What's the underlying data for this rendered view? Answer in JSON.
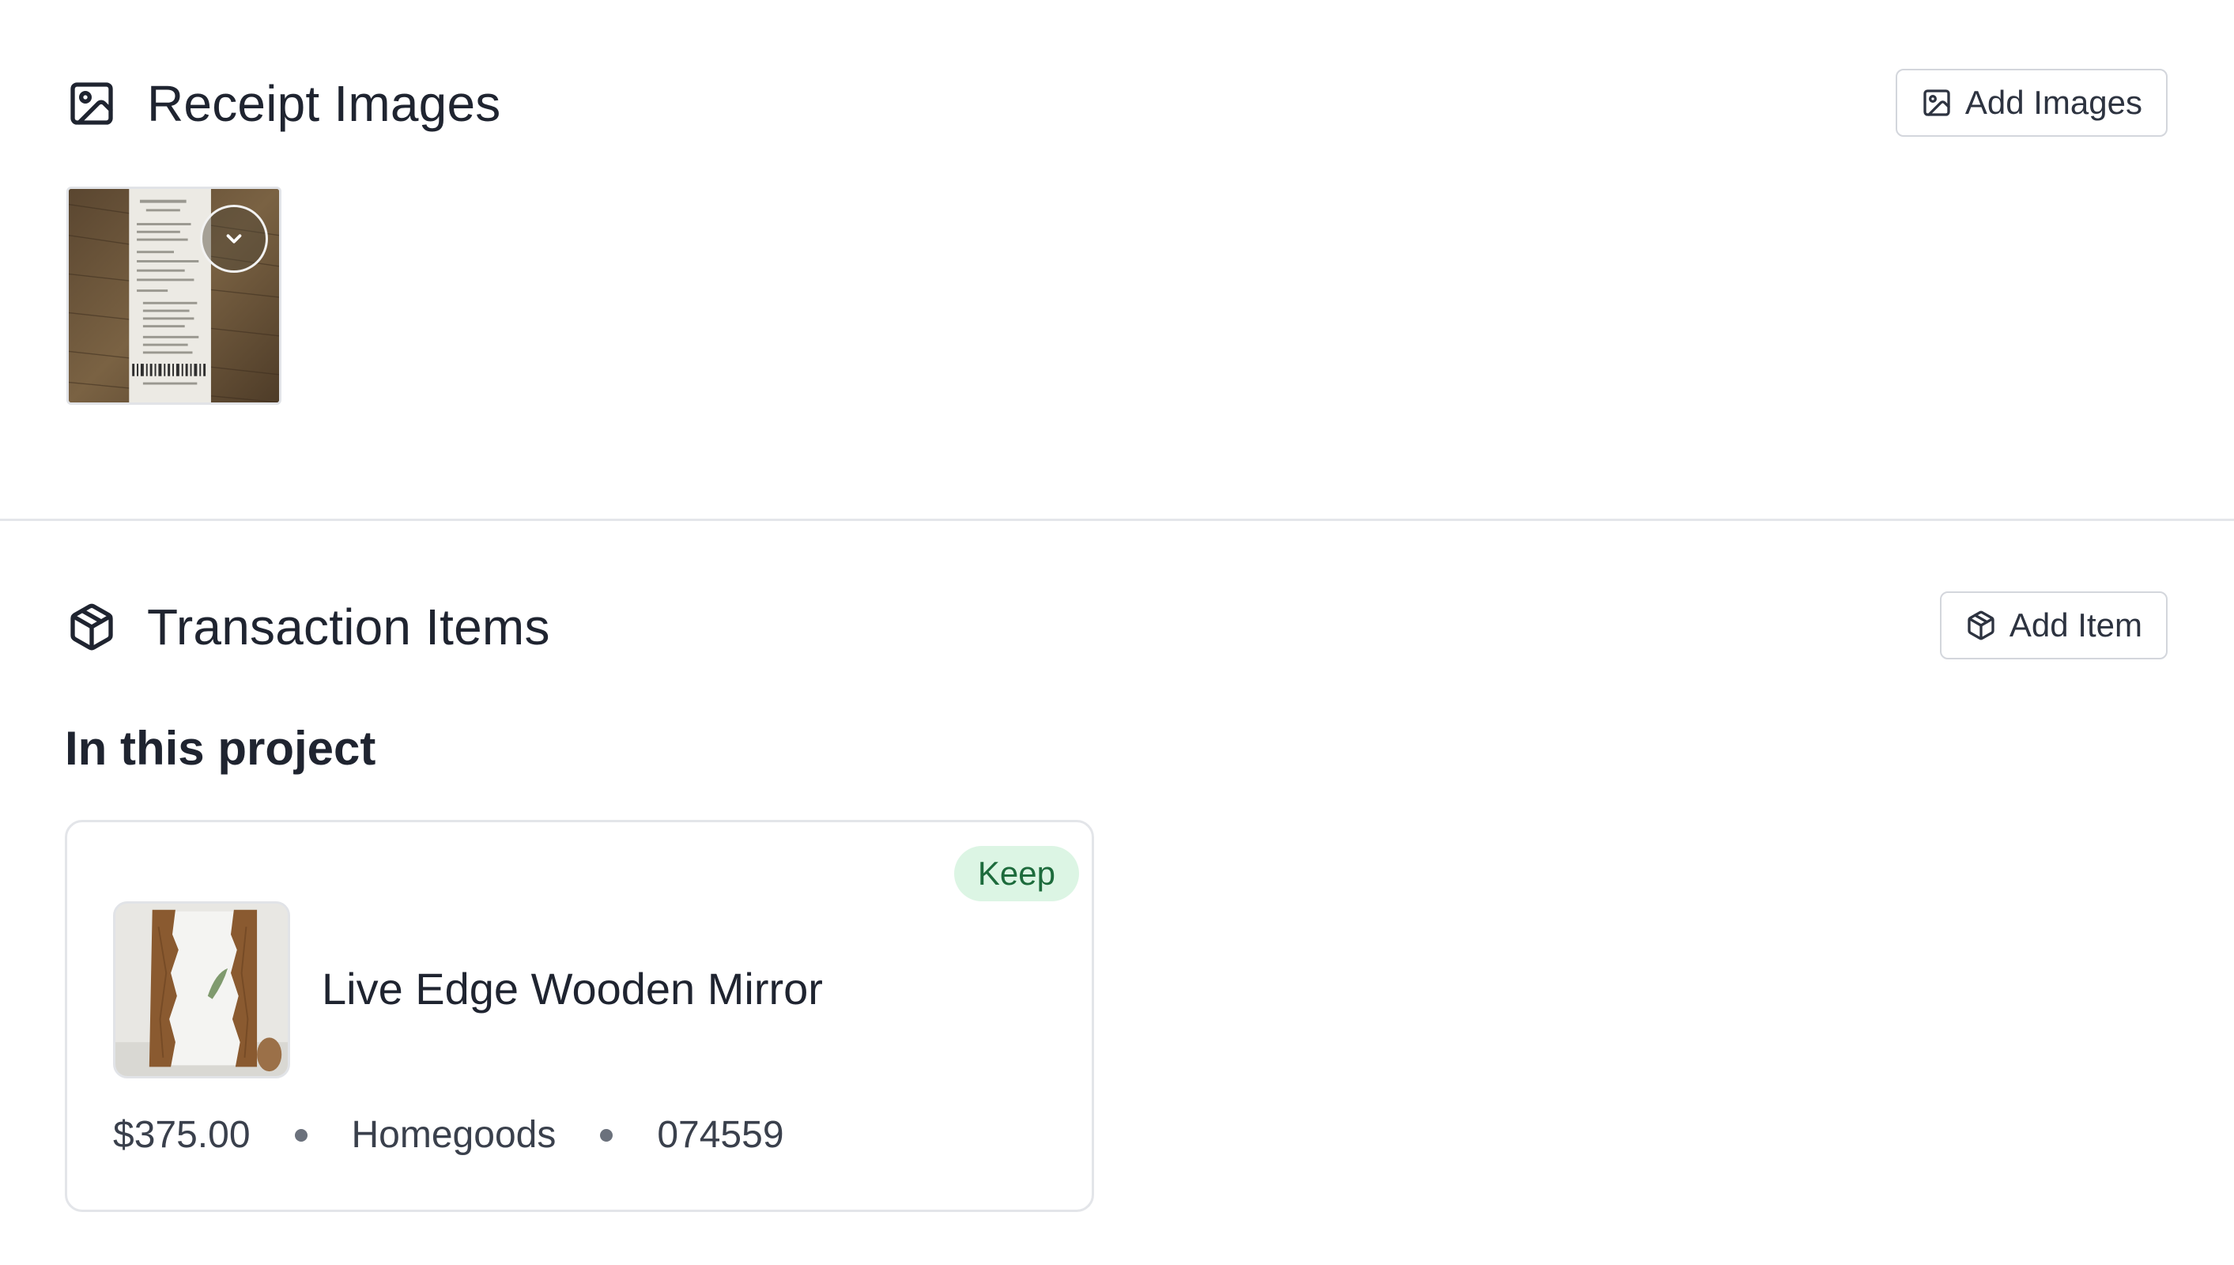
{
  "receipts": {
    "title": "Receipt Images",
    "icon": "image-icon",
    "add_button_label": "Add Images",
    "add_button_icon": "image-icon",
    "images": [
      {
        "menu_icon": "chevron-down-icon"
      }
    ]
  },
  "items": {
    "title": "Transaction Items",
    "icon": "package-icon",
    "add_button_label": "Add Item",
    "add_button_icon": "package-icon",
    "group_heading": "In this project",
    "list": [
      {
        "name": "Live Edge Wooden Mirror",
        "status": "Keep",
        "price": "$375.00",
        "source": "Homegoods",
        "sku": "074559",
        "thumbnail_icon": "product-photo"
      }
    ]
  },
  "colors": {
    "text": "#1f2430",
    "border": "#d3d6dc",
    "badge_bg": "#dcf5e4",
    "badge_text": "#1d6b3c",
    "divider": "#e4e6ea"
  }
}
